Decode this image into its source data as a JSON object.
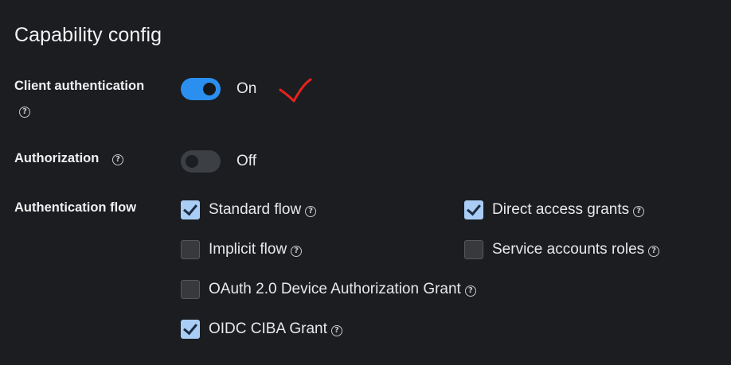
{
  "section": {
    "title": "Capability config"
  },
  "client_auth": {
    "label": "Client authentication",
    "toggle_state": "On",
    "enabled": true
  },
  "authorization": {
    "label": "Authorization",
    "toggle_state": "Off",
    "enabled": false
  },
  "auth_flow": {
    "label": "Authentication flow",
    "options": [
      {
        "label": "Standard flow",
        "checked": true
      },
      {
        "label": "Direct access grants",
        "checked": true
      },
      {
        "label": "Implicit flow",
        "checked": false
      },
      {
        "label": "Service accounts roles",
        "checked": false
      },
      {
        "label": "OAuth 2.0 Device Authorization Grant",
        "checked": false
      },
      {
        "label": "OIDC CIBA Grant",
        "checked": true
      }
    ]
  },
  "icons": {
    "help": "?"
  },
  "colors": {
    "background": "#1b1d21",
    "toggle_on": "#2b8ff0",
    "toggle_off": "#3c3f43",
    "checkbox_checked": "#a9cdf5",
    "annotation": "#e8231c"
  }
}
